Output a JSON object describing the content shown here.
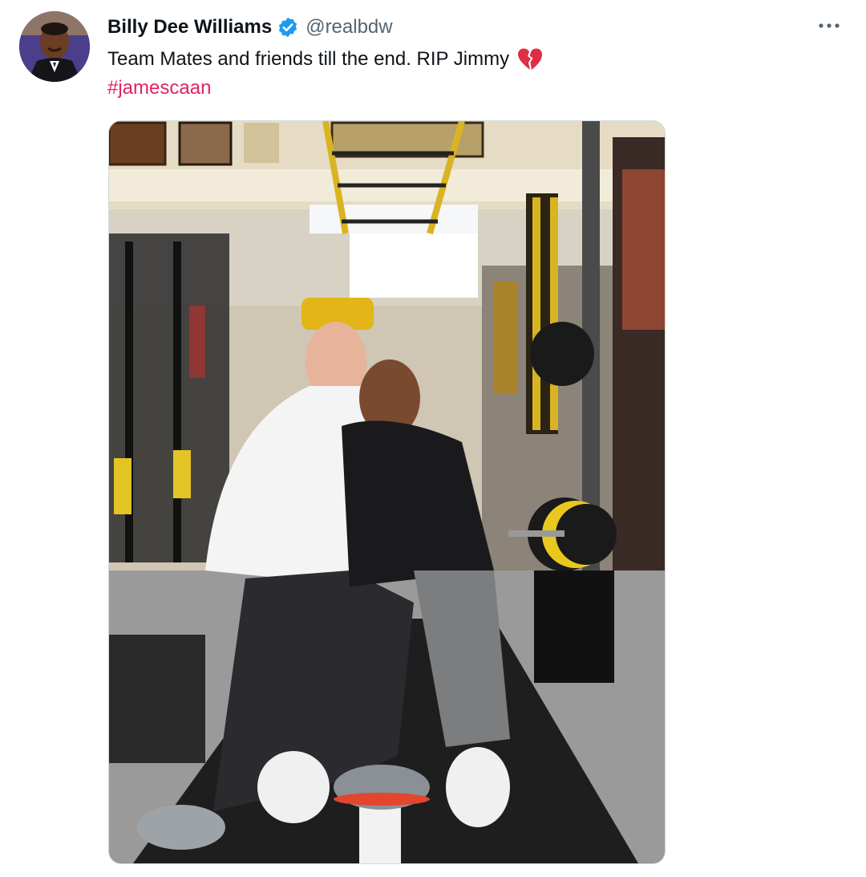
{
  "tweet": {
    "display_name": "Billy Dee Williams",
    "handle": "@realbdw",
    "text": "Team Mates and friends till the end. RIP Jimmy",
    "hashtag": "#jamescaan",
    "verified_icon": "verified-badge-icon",
    "emoji_icon": "broken-heart-icon",
    "more_icon": "more-options-icon"
  },
  "colors": {
    "text": "#0f1419",
    "secondary": "#536471",
    "hashtag": "#e0245e",
    "verified": "#1d9bf0",
    "broken_heart": "#e0245e"
  }
}
